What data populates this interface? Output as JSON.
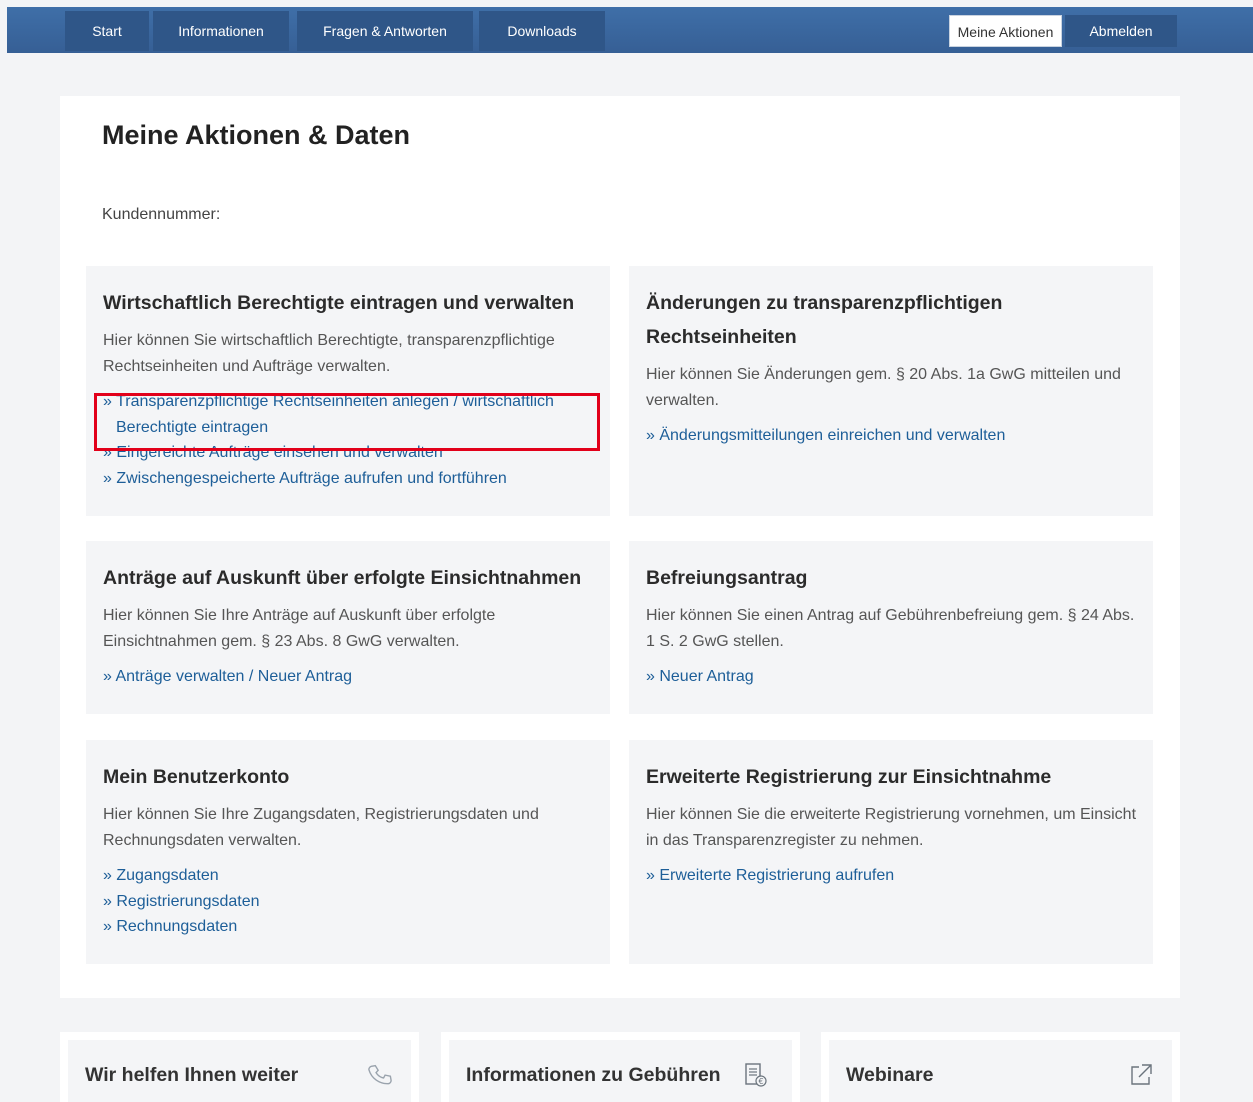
{
  "nav": {
    "items": [
      "Start",
      "Informationen",
      "Fragen & Antworten",
      "Downloads"
    ],
    "meine_aktionen": "Meine Aktionen",
    "abmelden": "Abmelden"
  },
  "page": {
    "title": "Meine Aktionen & Daten",
    "kundennummer_label": "Kundennummer:"
  },
  "sections": [
    {
      "title": "Wirtschaftlich Berechtigte eintragen und verwalten",
      "text": "Hier können Sie wirtschaftlich Berechtigte, transparenzpflichtige Rechtseinheiten und Aufträge verwalten.",
      "links": [
        "» Transparenzpflichtige Rechtseinheiten anlegen / wirtschaftlich Berechtigte eintragen",
        "» Eingereichte Aufträge einsehen und verwalten",
        "» Zwischengespeicherte Aufträge aufrufen und fortführen"
      ]
    },
    {
      "title": "Änderungen zu transparenzpflichtigen Rechtseinheiten",
      "text": "Hier können Sie Änderungen gem. § 20 Abs. 1a GwG mitteilen und verwalten.",
      "links": [
        "» Änderungsmitteilungen einreichen und verwalten"
      ]
    },
    {
      "title": "Anträge auf Auskunft über erfolgte Einsichtnahmen",
      "text": "Hier können Sie Ihre Anträge auf Auskunft über erfolgte Einsichtnahmen gem. § 23 Abs. 8 GwG verwalten.",
      "links": [
        "» Anträge verwalten / Neuer Antrag"
      ]
    },
    {
      "title": "Befreiungsantrag",
      "text": "Hier können Sie einen Antrag auf Gebührenbefreiung gem. § 24 Abs. 1 S. 2 GwG stellen.",
      "links": [
        "» Neuer Antrag"
      ]
    },
    {
      "title": "Mein Benutzerkonto",
      "text": "Hier können Sie Ihre Zugangsdaten, Registrierungsdaten und Rechnungsdaten verwalten.",
      "links": [
        "» Zugangsdaten",
        "» Registrierungsdaten",
        "» Rechnungsdaten"
      ]
    },
    {
      "title": "Erweiterte Registrierung zur Einsichtnahme",
      "text": "Hier können Sie die erweiterte Registrierung vornehmen, um Einsicht in das Transparenzregister zu nehmen.",
      "links": [
        "» Erweiterte Registrierung aufrufen"
      ]
    }
  ],
  "bottom_cards": [
    {
      "label": "Wir helfen Ihnen weiter",
      "icon": "phone-icon"
    },
    {
      "label": "Informationen zu Gebühren",
      "icon": "invoice-euro-icon"
    },
    {
      "label": "Webinare",
      "icon": "external-link-icon"
    }
  ],
  "colors": {
    "nav": "#3f6fa8",
    "nav_item": "#2f5688",
    "link": "#1d5e98",
    "highlight": "#e2001a"
  }
}
